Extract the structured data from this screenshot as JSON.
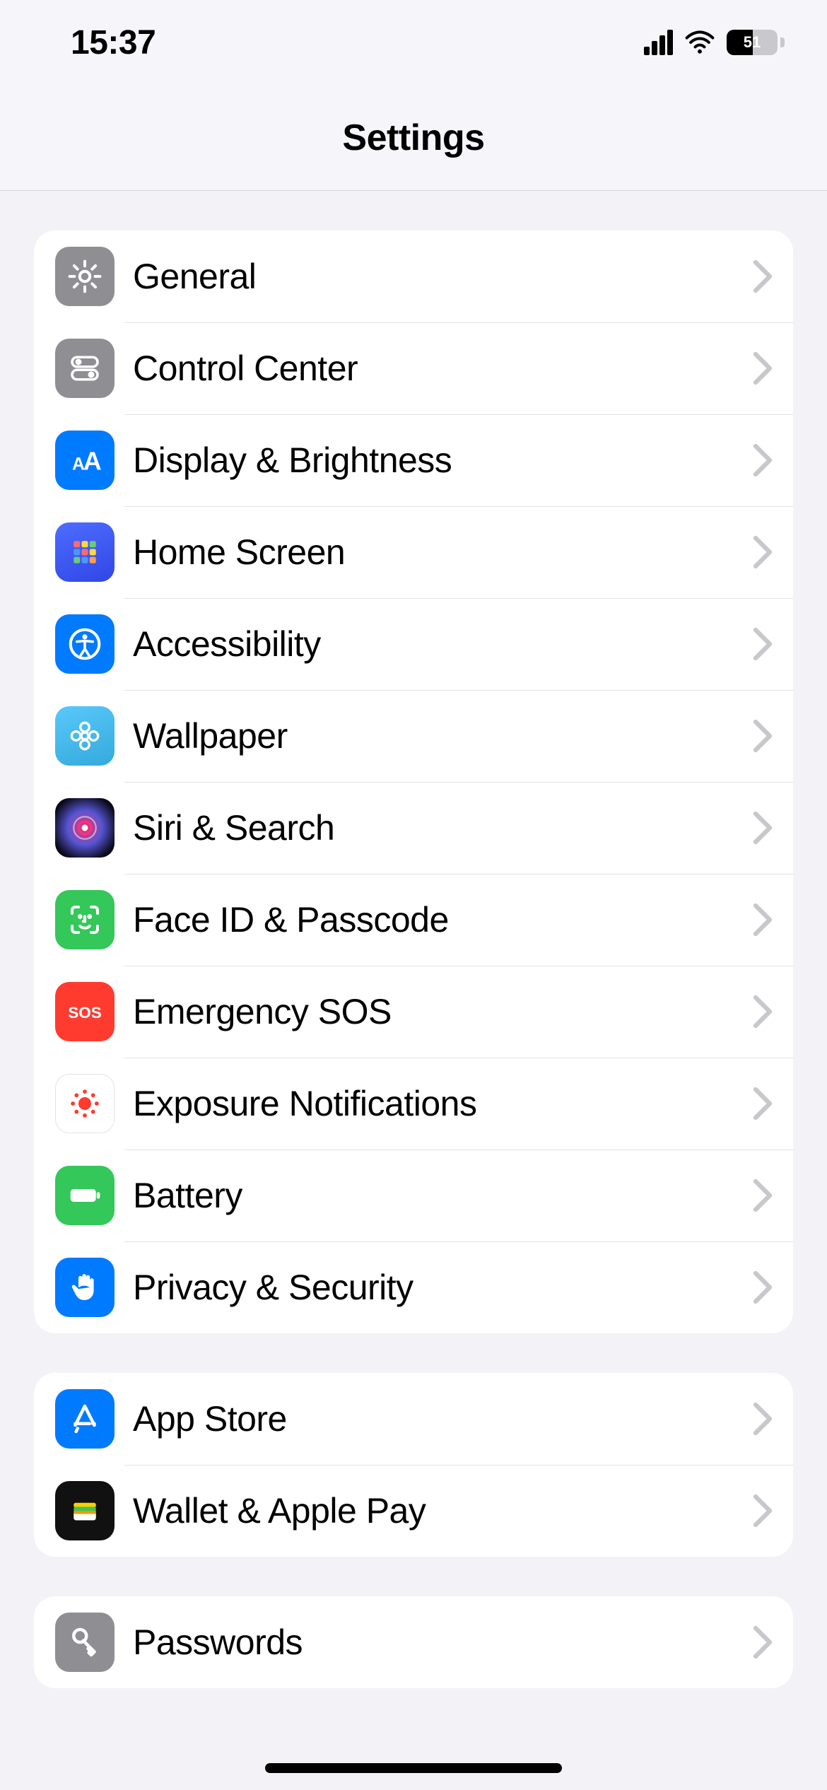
{
  "status": {
    "time": "15:37",
    "battery_percent": "51"
  },
  "nav": {
    "title": "Settings"
  },
  "groups": [
    {
      "rows": [
        {
          "id": "general",
          "label": "General",
          "icon": "gear",
          "tile": "bg-gray"
        },
        {
          "id": "control-center",
          "label": "Control Center",
          "icon": "toggles",
          "tile": "bg-gray"
        },
        {
          "id": "display-brightness",
          "label": "Display & Brightness",
          "icon": "text-size",
          "tile": "bg-blue"
        },
        {
          "id": "home-screen",
          "label": "Home Screen",
          "icon": "app-grid",
          "tile": "bg-indigo"
        },
        {
          "id": "accessibility",
          "label": "Accessibility",
          "icon": "accessibility",
          "tile": "bg-blue"
        },
        {
          "id": "wallpaper",
          "label": "Wallpaper",
          "icon": "flower",
          "tile": "bg-cyan"
        },
        {
          "id": "siri-search",
          "label": "Siri & Search",
          "icon": "siri",
          "tile": "bg-siri"
        },
        {
          "id": "face-id",
          "label": "Face ID & Passcode",
          "icon": "faceid",
          "tile": "bg-green"
        },
        {
          "id": "emergency-sos",
          "label": "Emergency SOS",
          "icon": "sos",
          "tile": "bg-red"
        },
        {
          "id": "exposure-notifications",
          "label": "Exposure Notifications",
          "icon": "exposure",
          "tile": "bg-white"
        },
        {
          "id": "battery",
          "label": "Battery",
          "icon": "battery",
          "tile": "bg-green"
        },
        {
          "id": "privacy-security",
          "label": "Privacy & Security",
          "icon": "hand",
          "tile": "bg-blue"
        }
      ]
    },
    {
      "rows": [
        {
          "id": "app-store",
          "label": "App Store",
          "icon": "appstore",
          "tile": "bg-blue2"
        },
        {
          "id": "wallet",
          "label": "Wallet & Apple Pay",
          "icon": "wallet",
          "tile": "bg-black"
        }
      ]
    },
    {
      "rows": [
        {
          "id": "passwords",
          "label": "Passwords",
          "icon": "key",
          "tile": "bg-gray"
        }
      ]
    }
  ]
}
